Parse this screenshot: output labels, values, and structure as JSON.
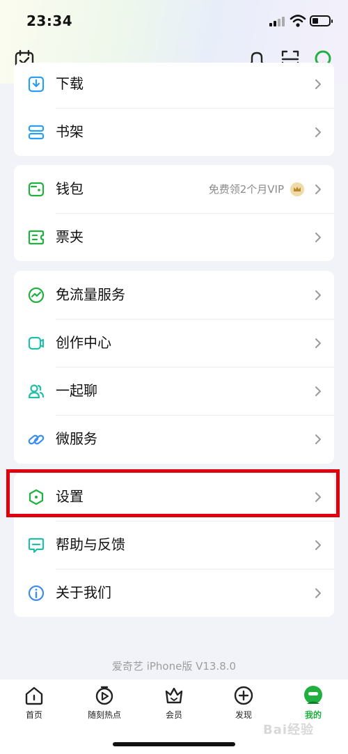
{
  "status_bar": {
    "time": "23:34"
  },
  "top_icons": [
    "calendar-check-icon",
    "bell-icon",
    "scan-icon",
    "search-icon"
  ],
  "groups": [
    {
      "items": [
        {
          "label": "下载",
          "icon": "download-icon"
        },
        {
          "label": "书架",
          "icon": "bookshelf-icon"
        }
      ]
    },
    {
      "items": [
        {
          "label": "钱包",
          "icon": "wallet-icon",
          "note": "免费领2个月VIP",
          "badge": "crown-badge-icon"
        },
        {
          "label": "票夹",
          "icon": "ticket-icon"
        }
      ]
    },
    {
      "items": [
        {
          "label": "免流量服务",
          "icon": "data-free-icon"
        },
        {
          "label": "创作中心",
          "icon": "creation-icon"
        },
        {
          "label": "一起聊",
          "icon": "chat-people-icon"
        },
        {
          "label": "微服务",
          "icon": "micro-service-icon"
        }
      ]
    },
    {
      "items": [
        {
          "label": "设置",
          "icon": "settings-icon",
          "highlighted": true
        },
        {
          "label": "帮助与反馈",
          "icon": "help-feedback-icon"
        },
        {
          "label": "关于我们",
          "icon": "info-icon"
        }
      ]
    }
  ],
  "version_text": "爱奇艺 iPhone版 V13.8.0",
  "tabbar": [
    {
      "label": "首页",
      "icon": "home-icon"
    },
    {
      "label": "随刻热点",
      "icon": "play-clock-icon"
    },
    {
      "label": "会员",
      "icon": "vip-crown-icon"
    },
    {
      "label": "发现",
      "icon": "discover-plus-icon"
    },
    {
      "label": "我的",
      "icon": "profile-icon",
      "active": true
    }
  ],
  "colors": {
    "accent": "#1fb040",
    "highlight_box": "#e0000d",
    "background": "#f1f3f9"
  },
  "watermark": "Bai经验"
}
